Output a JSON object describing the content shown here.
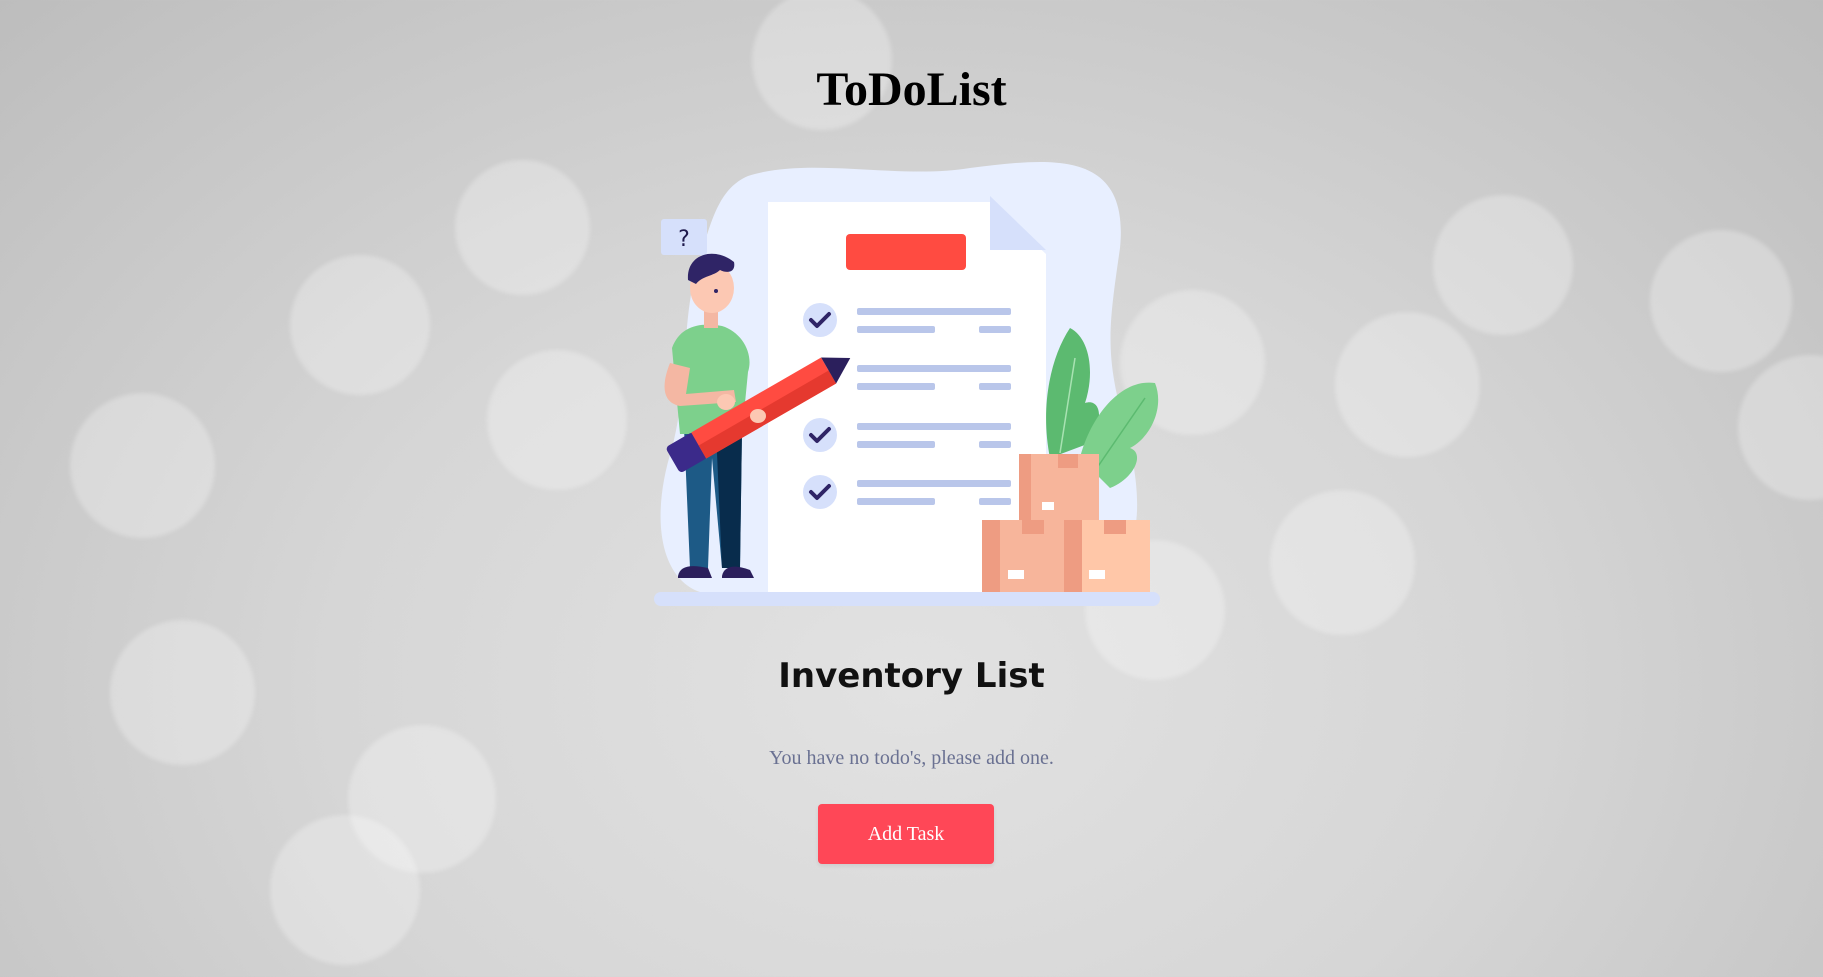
{
  "app": {
    "title": "ToDoList"
  },
  "hero": {
    "question_mark": "?"
  },
  "list": {
    "title": "Inventory List",
    "empty_message": "You have no todo's, please add one.",
    "add_button_label": "Add Task"
  },
  "colors": {
    "accent": "#ff4757",
    "muted_text": "#6a7192",
    "illustration_blob": "#e8efff",
    "illustration_lines": "#b9c6ea"
  }
}
